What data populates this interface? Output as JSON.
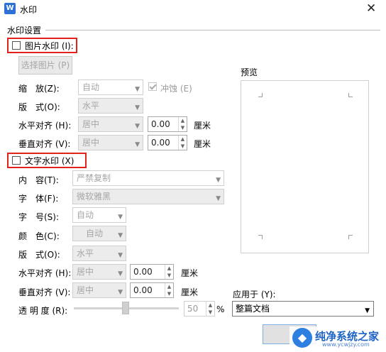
{
  "window": {
    "title": "水印",
    "app_icon_letter": "W"
  },
  "group": {
    "title": "水印设置"
  },
  "picture": {
    "checkbox_label": "图片水印 (I):",
    "select_button": "选择图片 (P)",
    "scale_label": "缩　放(Z):",
    "scale_value": "自动",
    "washout_label": "冲蚀 (E)",
    "layout_label": "版　式(O):",
    "layout_value": "水平",
    "halign_label": "水平对齐 (H):",
    "halign_value": "居中",
    "halign_offset": "0.00",
    "valign_label": "垂直对齐 (V):",
    "valign_value": "居中",
    "valign_offset": "0.00",
    "unit": "厘米"
  },
  "text": {
    "checkbox_label": "文字水印 (X)",
    "content_label": "内　容(T):",
    "content_value": "严禁复制",
    "font_label": "字　体(F):",
    "font_value": "微软雅黑",
    "size_label": "字　号(S):",
    "size_value": "自动",
    "color_label": "颜　色(C):",
    "color_value": "自动",
    "layout_label": "版　式(O):",
    "layout_value": "水平",
    "halign_label": "水平对齐 (H):",
    "halign_value": "居中",
    "halign_offset": "0.00",
    "valign_label": "垂直对齐 (V):",
    "valign_value": "居中",
    "valign_offset": "0.00",
    "unit": "厘米",
    "transparency_label": "透 明 度 (R):",
    "transparency_value": "50",
    "transparency_unit": "%"
  },
  "preview": {
    "label": "预览"
  },
  "apply": {
    "label": "应用于 (Y):",
    "value": "整篇文档"
  },
  "watermark_logo": {
    "brand": "纯净系统之家",
    "url": "www.ycwjzy.com"
  },
  "colors": {
    "highlight": "#e0241c",
    "accent": "#2e6fd8",
    "disabled_text": "#9b9b9b"
  }
}
